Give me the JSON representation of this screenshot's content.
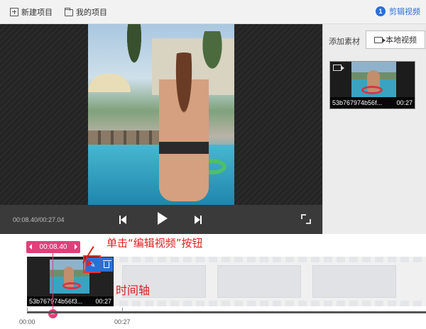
{
  "toolbar": {
    "new_project": "新建项目",
    "my_projects": "我的项目",
    "step_number": "1",
    "step_label": "剪辑视频"
  },
  "player": {
    "timecode": "00:08.40/00:27.04"
  },
  "panel": {
    "add_material": "添加素材",
    "local_video": "本地视频",
    "asset": {
      "filename": "53b767974b56f...",
      "duration": "00:27"
    }
  },
  "timeline": {
    "playhead_time": "00:08.40",
    "clip": {
      "filename": "53b767974b56f3...",
      "duration": "00:27"
    },
    "ruler": [
      "00:00",
      "00:27"
    ]
  },
  "annotations": {
    "click_edit": "单击“编辑视频”按钮",
    "timeline": "时间轴"
  },
  "colors": {
    "accent_blue": "#2a6fd6",
    "playhead_pink": "#e0407a",
    "annotation_red": "#e02020"
  }
}
